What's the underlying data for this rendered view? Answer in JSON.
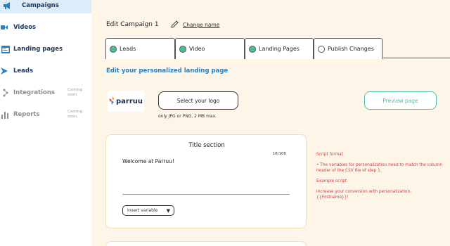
{
  "sidebar": {
    "items": [
      {
        "label": "Campaigns",
        "icon": "megaphone-icon",
        "active": true
      },
      {
        "label": "Videos",
        "icon": "video-camera-icon"
      },
      {
        "label": "Landing pages",
        "icon": "landing-page-icon"
      },
      {
        "label": "Leads",
        "icon": "leads-icon"
      },
      {
        "label": "Integrations",
        "icon": "integrations-icon",
        "coming": "Coming soon"
      },
      {
        "label": "Reports",
        "icon": "bar-chart-icon",
        "coming": "Coming soon"
      }
    ]
  },
  "header": {
    "edit_title": "Edit Campaign 1",
    "change_name": "Change name"
  },
  "tabs": [
    {
      "label": "Leads",
      "status": "done"
    },
    {
      "label": "Video",
      "status": "done"
    },
    {
      "label": "Landing Pages",
      "status": "done"
    },
    {
      "label": "Publish Changes",
      "status": "pending"
    }
  ],
  "landing": {
    "heading": "Edit your personalized landing page",
    "logo_text": "parruu",
    "select_logo": "Select your logo",
    "logo_hint": "only JPG or PNG, 2 MB max.",
    "preview": "Preview page"
  },
  "title_section": {
    "title": "Title section",
    "counter": "18/100",
    "text": "Welcome at Parruu!",
    "insert_variable": "Insert variable"
  },
  "notes": {
    "heading": "Script format",
    "rule": "• The variables for personalization need to match the column header of the CSV file of step 1.",
    "example_heading": "Example script",
    "example": "Increase your conversion with personalization. {{Firstname}}!"
  },
  "colors": {
    "accent_blue": "#2a7fc1",
    "teal": "#49c0b0",
    "green_dot": "#4cbf9a",
    "note_red": "#d63b3b",
    "page_bg": "#fdf5e8"
  }
}
